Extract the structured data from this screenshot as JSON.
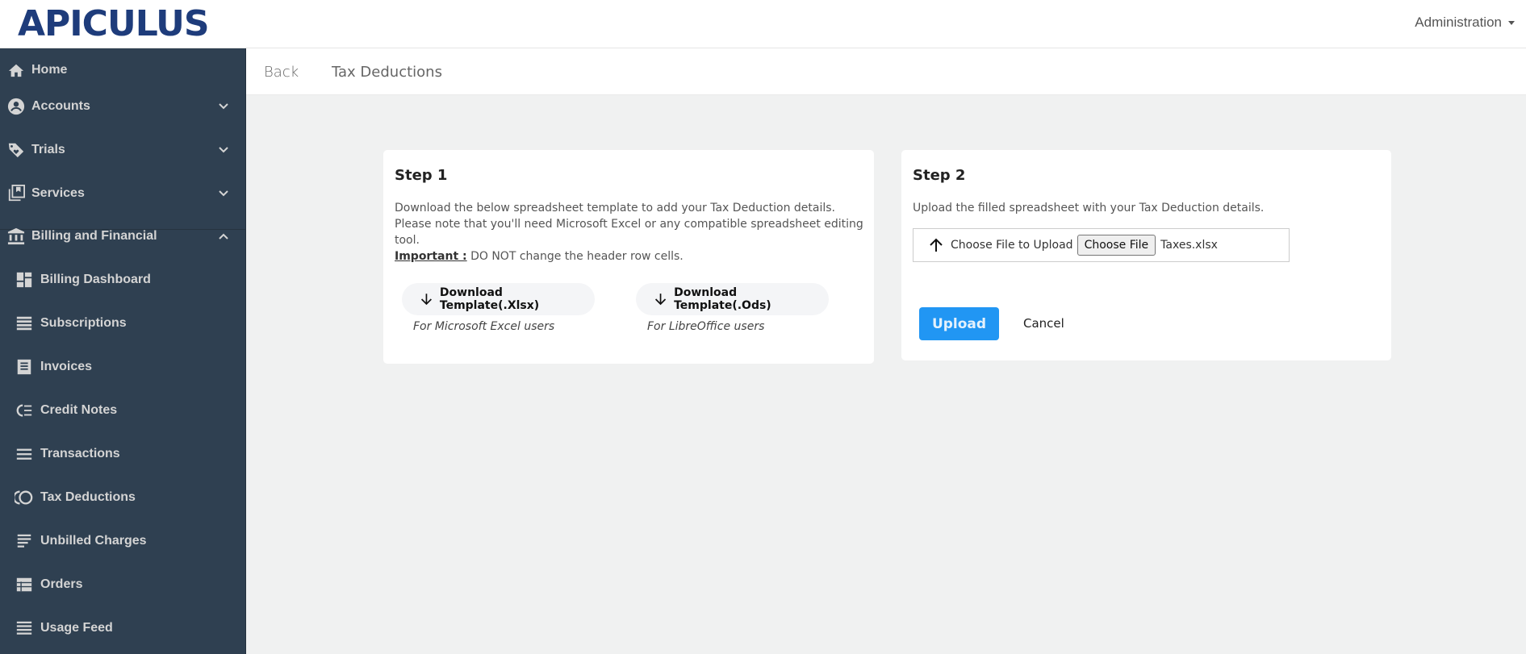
{
  "header": {
    "logo": "APICULUS",
    "admin_menu": "Administration"
  },
  "sidebar": {
    "items": [
      {
        "label": "Home",
        "icon": "home-icon"
      },
      {
        "label": "Accounts",
        "icon": "account-circle-icon",
        "expandable": true,
        "expanded": false
      },
      {
        "label": "Trials",
        "icon": "tag-heart-icon",
        "expandable": true,
        "expanded": false
      },
      {
        "label": "Services",
        "icon": "library-icon",
        "expandable": true,
        "expanded": false
      },
      {
        "label": "Billing and Financial",
        "icon": "bank-icon",
        "expandable": true,
        "expanded": true
      }
    ],
    "subitems": [
      {
        "label": "Billing Dashboard",
        "icon": "dashboard-icon"
      },
      {
        "label": "Subscriptions",
        "icon": "list-icon"
      },
      {
        "label": "Invoices",
        "icon": "receipt-icon"
      },
      {
        "label": "Credit Notes",
        "icon": "credit-note-icon"
      },
      {
        "label": "Transactions",
        "icon": "menu-icon"
      },
      {
        "label": "Tax Deductions",
        "icon": "tax-icon"
      },
      {
        "label": "Unbilled Charges",
        "icon": "notes-icon"
      },
      {
        "label": "Orders",
        "icon": "table-icon"
      },
      {
        "label": "Usage Feed",
        "icon": "feed-icon"
      }
    ]
  },
  "subheader": {
    "back": "Back",
    "title": "Tax Deductions"
  },
  "step1": {
    "title": "Step 1",
    "line1": "Download the below spreadsheet template to add your Tax Deduction details.",
    "line2": "Please note that you'll need Microsoft Excel or any compatible spreadsheet editing tool.",
    "important_label": "Important :",
    "important_text": " DO NOT change the header row cells.",
    "download_xlsx": "Download Template(.Xlsx)",
    "download_ods": "Download Template(.Ods)",
    "hint_xlsx": "For Microsoft Excel users",
    "hint_ods": "For LibreOffice users"
  },
  "step2": {
    "title": "Step 2",
    "desc": "Upload the filled spreadsheet with your Tax Deduction details.",
    "file_label": "Choose File to Upload",
    "choose_button": "Choose File",
    "file_name": "Taxes.xlsx",
    "upload_button": "Upload",
    "cancel_button": "Cancel"
  },
  "colors": {
    "sidebar_bg": "#2f4051",
    "brand": "#1e3c7b",
    "primary": "#2196f3"
  }
}
